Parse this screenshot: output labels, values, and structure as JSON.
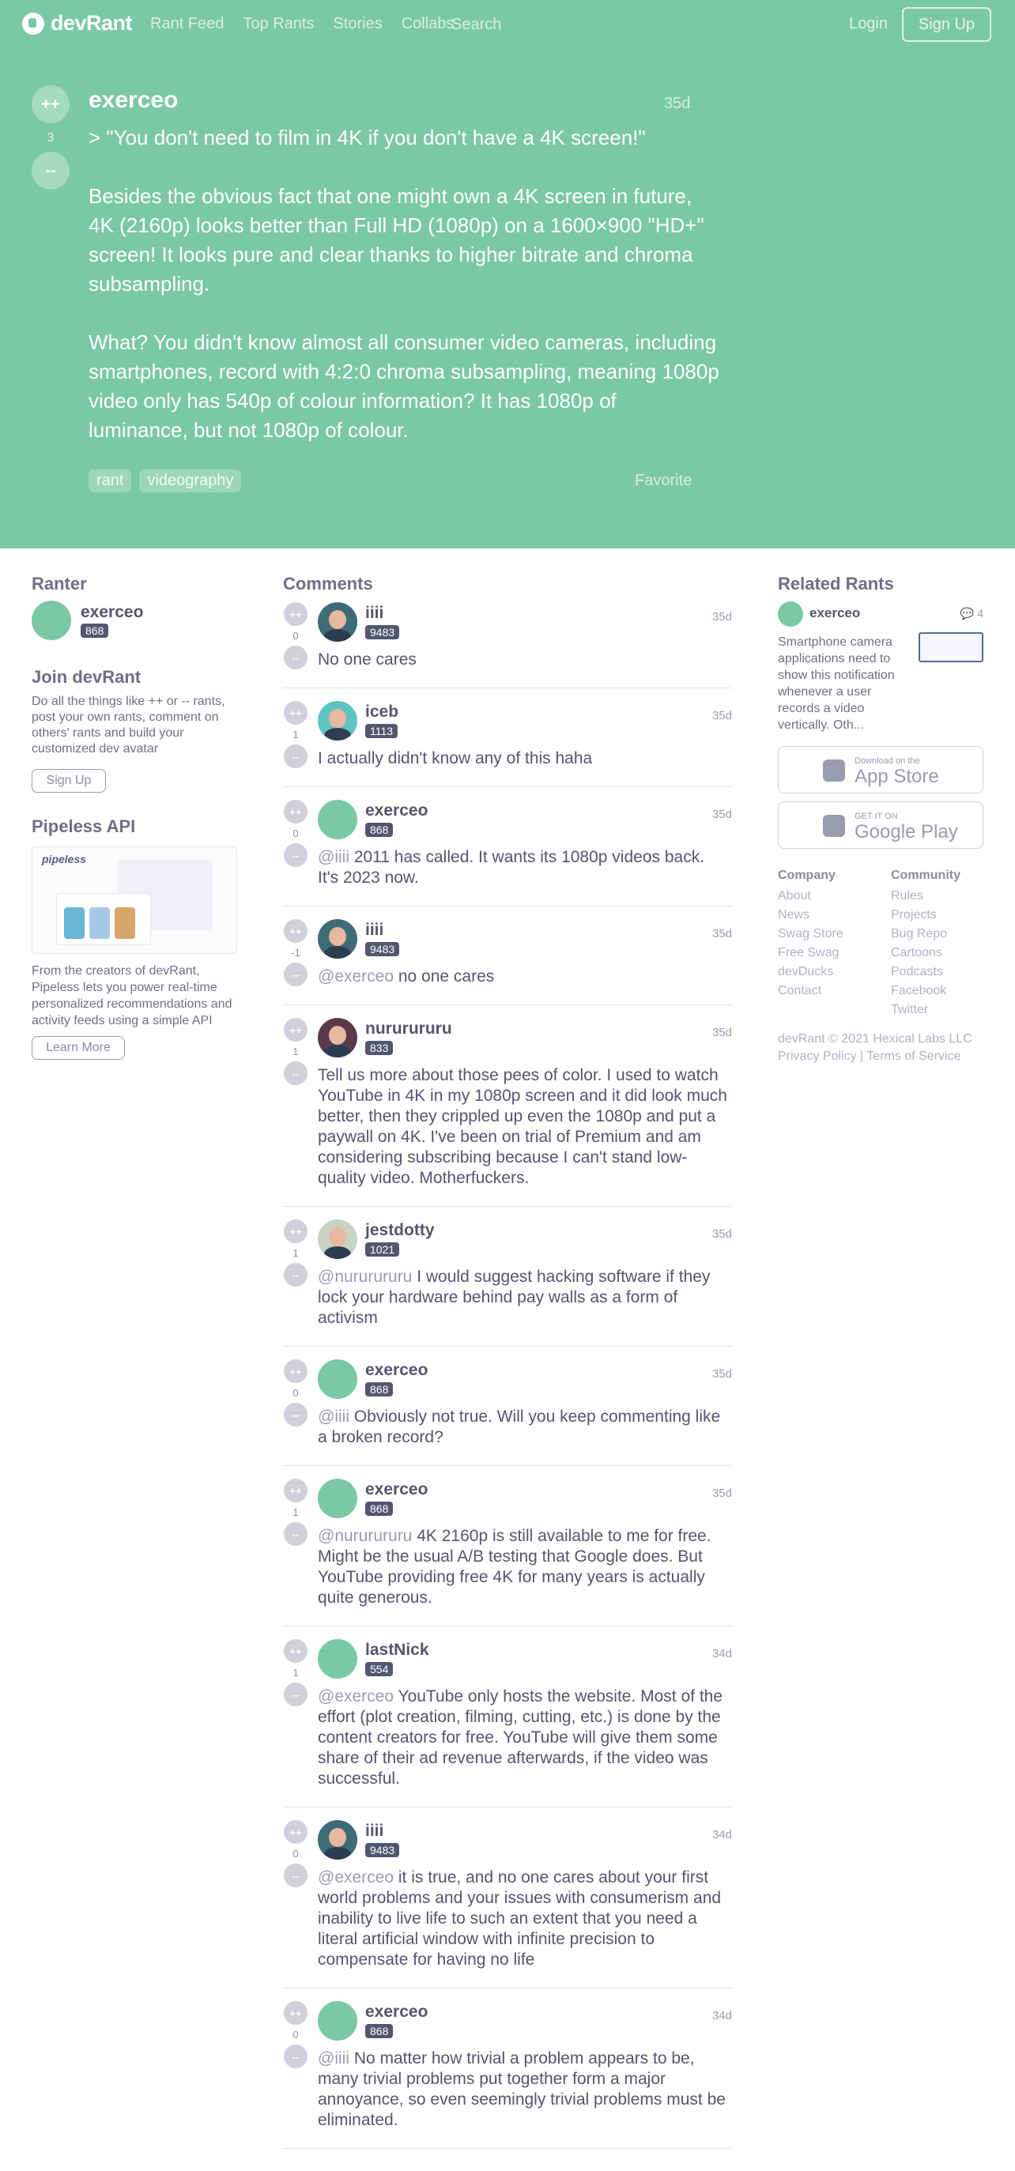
{
  "nav": {
    "logo": "devRant",
    "links": [
      "Rant Feed",
      "Top Rants",
      "Stories",
      "Collabs"
    ],
    "search": "Search",
    "login": "Login",
    "signup": "Sign Up"
  },
  "rant": {
    "upvote": "++",
    "downvote": "--",
    "score": "3",
    "user": "exerceo",
    "time": "35d",
    "paragraphs": [
      "> \"You don't need to film in 4K if you don't have a 4K screen!\"",
      "Besides the obvious fact that one might own a 4K screen in future, 4K (2160p) looks better than Full HD (1080p) on a 1600×900 \"HD+\" screen! It looks pure and clear thanks to higher bitrate and chroma subsampling.",
      "What? You didn't know almost all consumer video cameras, including smartphones, record with 4:2:0 chroma subsampling, meaning 1080p video only has 540p of colour information? It has 1080p of luminance, but not 1080p of colour."
    ],
    "tags": [
      "rant",
      "videography"
    ],
    "favorite": "Favorite"
  },
  "ranter": {
    "title": "Ranter",
    "name": "exerceo",
    "score": "868"
  },
  "join": {
    "title": "Join devRant",
    "text": "Do all the things like ++ or -- rants, post your own rants, comment on others' rants and build your customized dev avatar",
    "button": "Sign Up"
  },
  "pipeless": {
    "title": "Pipeless API",
    "logo": "pipeless",
    "text": "From the creators of devRant, Pipeless lets you power real-time personalized recommendations and activity feeds using a simple API",
    "button": "Learn More"
  },
  "comments_title": "Comments",
  "comments": [
    {
      "user": "iiii",
      "score": "9483",
      "votes": "0",
      "time": "35d",
      "avatar": "photo",
      "mention": "",
      "text": "No one cares"
    },
    {
      "user": "iceb",
      "score": "1113",
      "votes": "1",
      "time": "35d",
      "avatar": "photo ph-teal",
      "mention": "",
      "text": "I actually didn't know any of this haha"
    },
    {
      "user": "exerceo",
      "score": "868",
      "votes": "0",
      "time": "35d",
      "avatar": "",
      "mention": "@iiii",
      "text": " 2011 has called. It wants its 1080p videos back. It's 2023 now."
    },
    {
      "user": "iiii",
      "score": "9483",
      "votes": "-1",
      "time": "35d",
      "avatar": "photo",
      "mention": "@exerceo",
      "text": " no one cares"
    },
    {
      "user": "nururururu",
      "score": "833",
      "votes": "1",
      "time": "35d",
      "avatar": "photo ph-beard",
      "mention": "",
      "text": "Tell us more about those pees of color. I used to watch YouTube in 4K in my 1080p screen and it did look much better, then they crippled up even the 1080p and put a paywall on 4K. I've been on trial of Premium and am considering subscribing because I can't stand low-quality video. Motherfuckers."
    },
    {
      "user": "jestdotty",
      "score": "1021",
      "votes": "1",
      "time": "35d",
      "avatar": "photo ph-light",
      "mention": "@nururururu",
      "text": " I would suggest hacking software if they lock your hardware behind pay walls as a form of activism"
    },
    {
      "user": "exerceo",
      "score": "868",
      "votes": "0",
      "time": "35d",
      "avatar": "",
      "mention": "@iiii",
      "text": " Obviously not true. Will you keep commenting like a broken record?"
    },
    {
      "user": "exerceo",
      "score": "868",
      "votes": "1",
      "time": "35d",
      "avatar": "",
      "mention": "@nururururu",
      "text": " 4K 2160p is still available to me for free. Might be the usual A/B testing that Google does. But YouTube providing free 4K for many years is actually quite generous."
    },
    {
      "user": "lastNick",
      "score": "554",
      "votes": "1",
      "time": "34d",
      "avatar": "",
      "mention": "@exerceo",
      "text": " YouTube only hosts the website. Most of the effort (plot creation, filming, cutting, etc.) is done by the content creators for free. YouTube will give them some share of their ad revenue afterwards, if the video was successful."
    },
    {
      "user": "iiii",
      "score": "9483",
      "votes": "0",
      "time": "34d",
      "avatar": "photo",
      "mention": "@exerceo",
      "text": " it is true, and no one cares about your first world problems and your issues with consumerism and inability to live life to such an extent that you need a literal artificial window with infinite precision to compensate for having no life"
    },
    {
      "user": "exerceo",
      "score": "868",
      "votes": "0",
      "time": "34d",
      "avatar": "",
      "mention": "@iiii",
      "text": " No matter how trivial a problem appears to be, many trivial problems put together form a major annoyance, so even seemingly trivial problems must be eliminated."
    }
  ],
  "related": {
    "title": "Related Rants",
    "user": "exerceo",
    "comments": "4",
    "text": "Smartphone camera applications need to show this notification whenever a user records a video vertically. Oth..."
  },
  "stores": {
    "apple_small": "Download on the",
    "apple_big": "App Store",
    "google_small": "GET IT ON",
    "google_big": "Google Play"
  },
  "footer": {
    "company_title": "Company",
    "company": [
      "About",
      "News",
      "Swag Store",
      "Free Swag",
      "devDucks",
      "Contact"
    ],
    "community_title": "Community",
    "community": [
      "Rules",
      "Projects",
      "Bug Repo",
      "Cartoons",
      "Podcasts",
      "Facebook",
      "Twitter"
    ],
    "copyright": "devRant © 2021 Hexical Labs LLC",
    "privacy": "Privacy Policy",
    "sep": "|",
    "terms": "Terms of Service"
  },
  "colors": {
    "brand_green": "#7bc8a4",
    "text_dark": "#54556e"
  }
}
